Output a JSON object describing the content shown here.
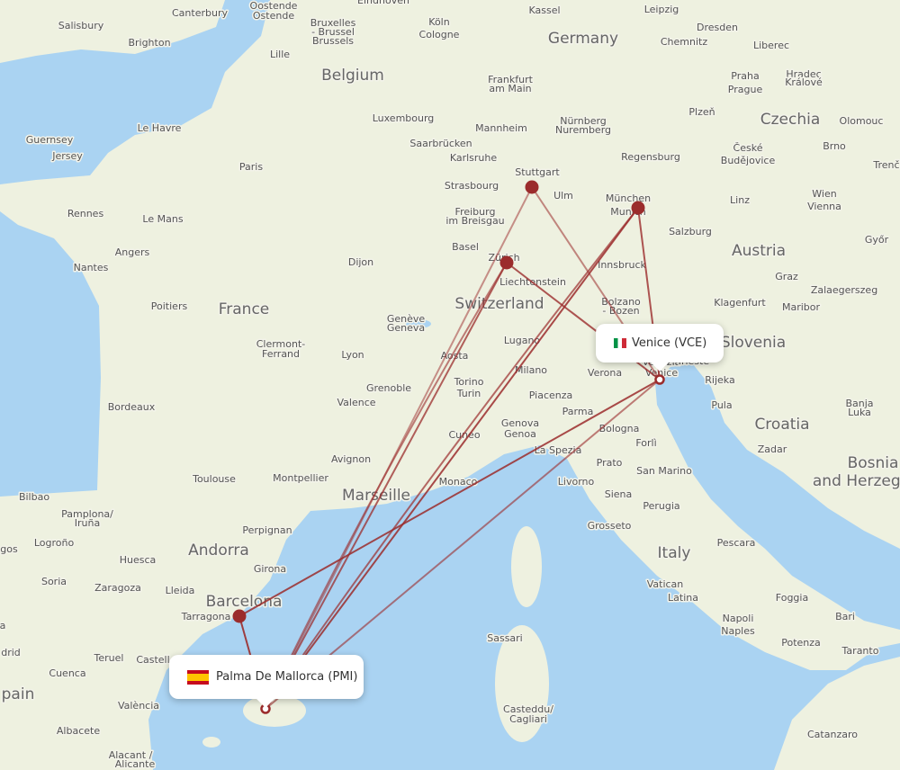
{
  "colors": {
    "sea": "#aad3f2",
    "land": "#eef1e0",
    "route": "#9b2c2c",
    "marker": "#9b2c2c"
  },
  "origin": {
    "name": "Palma De Mallorca (PMI)",
    "flag": "spain-flag"
  },
  "destination": {
    "name": "Venice (VCE)",
    "flag": "italy-flag"
  },
  "airports": [
    "Palma De Mallorca",
    "Venice",
    "Barcelona",
    "Stuttgart",
    "Zürich",
    "München",
    "Munich"
  ],
  "routes": [
    [
      "PMI",
      "BCN"
    ],
    [
      "PMI",
      "STR"
    ],
    [
      "PMI",
      "ZRH"
    ],
    [
      "PMI",
      "MUC"
    ],
    [
      "PMI",
      "VCE"
    ],
    [
      "BCN",
      "VCE"
    ],
    [
      "STR",
      "VCE"
    ],
    [
      "ZRH",
      "VCE"
    ],
    [
      "MUC",
      "VCE"
    ],
    [
      "ZRH",
      "PMI"
    ],
    [
      "MUC",
      "PMI"
    ]
  ],
  "place_labels": [
    "Salisbury",
    "Canterbury",
    "Brighton",
    "Oostende",
    "Ostende",
    "Bruxelles",
    "- Brussel",
    "Brussels",
    "Eindhoven",
    "Köln",
    "Cologne",
    "Kassel",
    "Leipzig",
    "Dresden",
    "Chemnitz",
    "Liberec",
    "Lille",
    "Praha",
    "Prague",
    "Hradec",
    "Králové",
    "Frankfurt",
    "am Main",
    "Guernsey",
    "Jersey",
    "Le Havre",
    "Luxembourg",
    "Mannheim",
    "Nürnberg",
    "Nuremberg",
    "Plzeň",
    "Olomouc",
    "Paris",
    "Saarbrücken",
    "Karlsruhe",
    "Regensburg",
    "České",
    "Budějovice",
    "Brno",
    "Trenč",
    "Stuttgart",
    "Strasbourg",
    "Ulm",
    "München",
    "Munich",
    "Wien",
    "Vienna",
    "Linz",
    "Rennes",
    "Le Mans",
    "Freiburg",
    "im Breisgau",
    "Salzburg",
    "Győr",
    "Angers",
    "Basel",
    "Zürich",
    "Nantes",
    "Dijon",
    "Innsbruck",
    "Graz",
    "Liechtenstein",
    "Zalaegerszeg",
    "Poitiers",
    "Bolzano",
    "- Bozen",
    "Klagenfurt",
    "Maribor",
    "Genève",
    "Geneva",
    "Clermont-",
    "Ferrand",
    "Lugano",
    "Lyon",
    "Aosta",
    "Milano",
    "Verona",
    "Venezia",
    "Venice",
    "Trieste",
    "Rijeka",
    "Grenoble",
    "Torino",
    "Turin",
    "Piacenza",
    "Valence",
    "Bordeaux",
    "Parma",
    "Pula",
    "Banja",
    "Luka",
    "Genova",
    "Genoa",
    "Bologna",
    "Cuneo",
    "Forlì",
    "Zadar",
    "La Spezia",
    "Avignon",
    "Prato",
    "San Marino",
    "Toulouse",
    "Montpellier",
    "Monaco",
    "Livorno",
    "Siena",
    "Bilbao",
    "Perugia",
    "Pamplona/",
    "Iruña",
    "Grosseto",
    "Logroño",
    "Perpignan",
    "Pescara",
    "Huesca",
    "Girona",
    "Soria",
    "Zaragoza",
    "Lleida",
    "Vatican",
    "Foggia",
    "Latina",
    "Tarragona",
    "Bari",
    "Napoli",
    "Naples",
    "Sassari",
    "Potenza",
    "Taranto",
    "Teruel",
    "Castell",
    "Cuenca",
    "València",
    "Albacete",
    "Casteddu/",
    "Cagliari",
    "Alacant /",
    "Alicante",
    "Catanzaro",
    "drid",
    "Palma",
    "gos",
    "a"
  ],
  "region_labels": [
    "Germany",
    "Belgium",
    "Czechia",
    "Austria",
    "Switzerland",
    "France",
    "Slovenia",
    "Croatia",
    "Bosnia",
    "and Herzego",
    "Marseille",
    "Andorra",
    "Italy",
    "Barcelona",
    "pain"
  ]
}
